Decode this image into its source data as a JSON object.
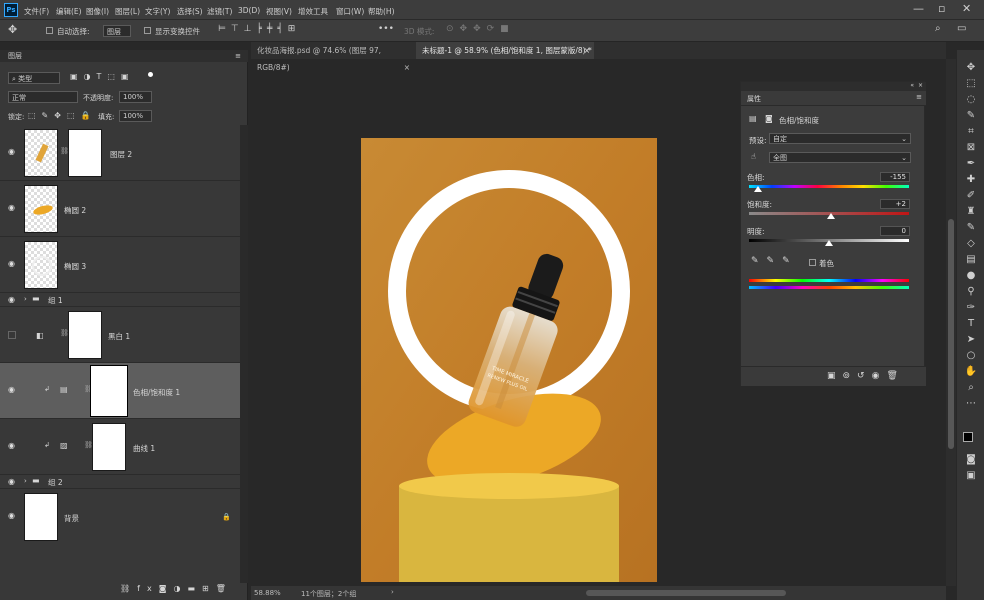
{
  "menubar": {
    "app_icon": "Ps",
    "items": [
      "文件(F)",
      "编辑(E)",
      "图像(I)",
      "图层(L)",
      "文字(Y)",
      "选择(S)",
      "滤镜(T)",
      "3D(D)",
      "视图(V)",
      "增效工具",
      "窗口(W)",
      "帮助(H)"
    ],
    "window_controls": [
      "—",
      "▫",
      "✕"
    ]
  },
  "options": {
    "auto_select_label": "自动选择:",
    "auto_select_value": "图层",
    "show_transform_label": "显示变换控件",
    "mode_3d_label": "3D 模式:",
    "more": "•••"
  },
  "tabs": [
    {
      "label": "化妆品海报.psd @ 74.6% (图层 97, RGB/8#)",
      "close": "×"
    },
    {
      "label": "未标题-1 @ 58.9% (色相/饱和度 1, 图层蒙版/8) *",
      "close": "×"
    }
  ],
  "layers_panel": {
    "title": "图层",
    "filter_label": "类型",
    "blend_mode": "正常",
    "opacity_label": "不透明度:",
    "opacity_value": "100%",
    "lock_label": "锁定:",
    "fill_label": "填充:",
    "fill_value": "100%",
    "layers": [
      {
        "name": "图层 2",
        "visible": true
      },
      {
        "name": "椭圆 2",
        "visible": true
      },
      {
        "name": "椭圆 3",
        "visible": true
      },
      {
        "name": "组 1",
        "visible": true,
        "group": true
      },
      {
        "name": "黑白 1",
        "visible": false
      },
      {
        "name": "色相/饱和度 1",
        "visible": true,
        "selected": true
      },
      {
        "name": "曲线 1",
        "visible": true
      },
      {
        "name": "组 2",
        "visible": true,
        "group": true
      },
      {
        "name": "背景",
        "visible": true
      }
    ],
    "footer_icons": [
      "link-icon",
      "fx-icon",
      "mask-icon",
      "adjustment-icon",
      "folder-icon",
      "new-layer-icon",
      "trash-icon"
    ]
  },
  "properties": {
    "tab": "属性",
    "adjustment_title": "色相/饱和度",
    "preset_label": "预设:",
    "preset_value": "自定",
    "channel_value": "全图",
    "hue_label": "色相:",
    "hue_value": "-155",
    "saturation_label": "饱和度:",
    "saturation_value": "+2",
    "lightness_label": "明度:",
    "lightness_value": "0",
    "colorize_label": "着色"
  },
  "canvas": {
    "background_color": "#c47f2a",
    "ring_color": "#ffffff",
    "ellipse_color": "#eca826",
    "pedestal_color": "#e7bd3f",
    "pedestal_top_color": "#f1c94a",
    "bottle_text_1": "TIME MIRACLE",
    "bottle_text_2": "RENEW PLUS OIL"
  },
  "status": {
    "zoom": "58.88%",
    "info": "11个图层；2个组"
  }
}
